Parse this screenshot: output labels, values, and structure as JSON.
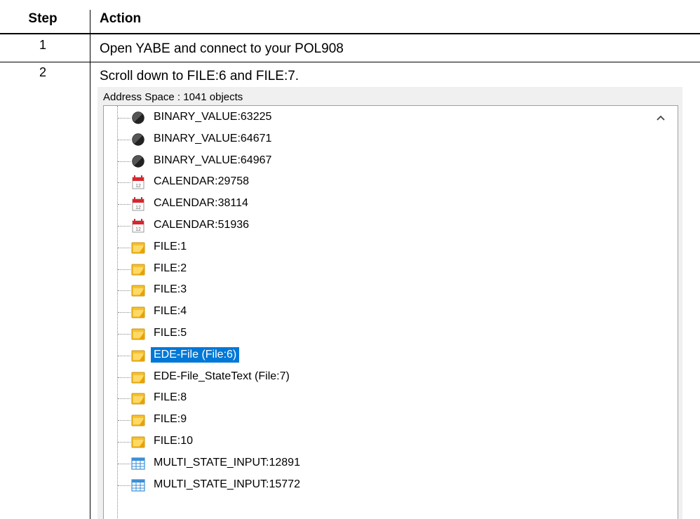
{
  "table": {
    "header_step": "Step",
    "header_action": "Action",
    "rows": [
      {
        "step": "1",
        "action": "Open YABE and connect to your POL908"
      },
      {
        "step": "2",
        "action": "Scroll down to FILE:6 and FILE:7."
      }
    ]
  },
  "screenshot": {
    "title": "Address Space : 1041 objects",
    "items": [
      {
        "label": "BINARY_VALUE:63225",
        "icon": "binary-value-icon"
      },
      {
        "label": "BINARY_VALUE:64671",
        "icon": "binary-value-icon"
      },
      {
        "label": "BINARY_VALUE:64967",
        "icon": "binary-value-icon"
      },
      {
        "label": "CALENDAR:29758",
        "icon": "calendar-icon"
      },
      {
        "label": "CALENDAR:38114",
        "icon": "calendar-icon"
      },
      {
        "label": "CALENDAR:51936",
        "icon": "calendar-icon"
      },
      {
        "label": "FILE:1",
        "icon": "file-icon"
      },
      {
        "label": "FILE:2",
        "icon": "file-icon"
      },
      {
        "label": "FILE:3",
        "icon": "file-icon"
      },
      {
        "label": "FILE:4",
        "icon": "file-icon"
      },
      {
        "label": "FILE:5",
        "icon": "file-icon"
      },
      {
        "label": "EDE-File (File:6)",
        "icon": "file-icon",
        "selected": true
      },
      {
        "label": "EDE-File_StateText (File:7)",
        "icon": "file-icon"
      },
      {
        "label": "FILE:8",
        "icon": "file-icon"
      },
      {
        "label": "FILE:9",
        "icon": "file-icon"
      },
      {
        "label": "FILE:10",
        "icon": "file-icon"
      },
      {
        "label": "MULTI_STATE_INPUT:12891",
        "icon": "multi-state-input-icon"
      },
      {
        "label": "MULTI_STATE_INPUT:15772",
        "icon": "multi-state-input-icon"
      }
    ]
  },
  "colors": {
    "selection": "#0078d7",
    "file_icon": "#f5c12e",
    "calendar_icon": "#d9262e",
    "table_icon": "#3b8fd6"
  }
}
